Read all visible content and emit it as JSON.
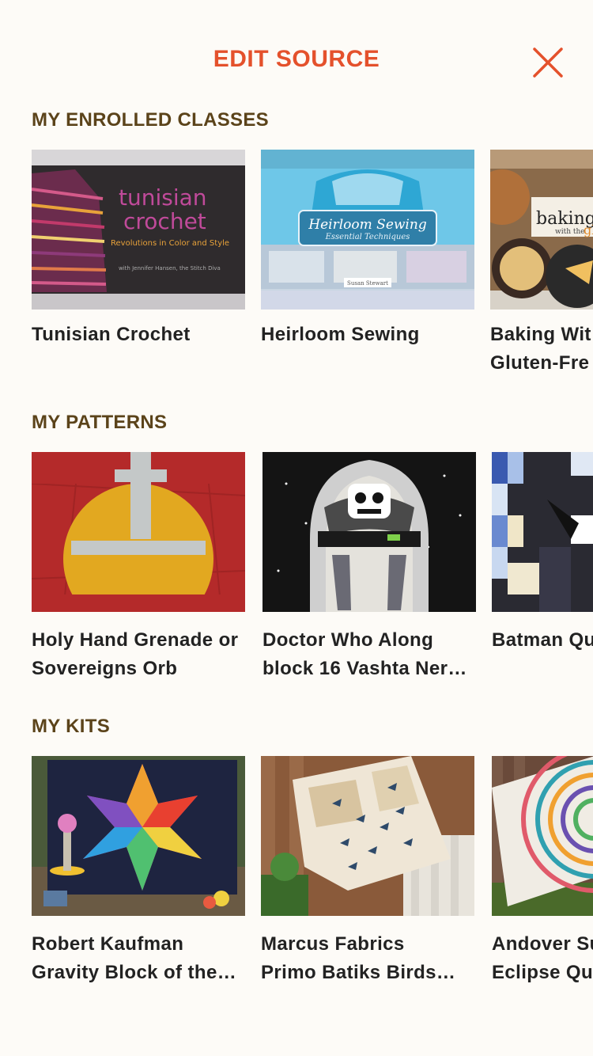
{
  "header": {
    "title": "EDIT SOURCE",
    "close_icon": "close-x-icon",
    "accent": "#e4512c"
  },
  "sections": {
    "classes": {
      "title": "MY ENROLLED CLASSES",
      "items": [
        {
          "line1": "Tunisian Crochet",
          "line2": "",
          "thumb_title": "tunisian crochet",
          "thumb_sub": "Revolutions in Color and Style",
          "thumb_credit": "with Jennifer Hansen, the Stitch Diva"
        },
        {
          "line1": "Heirloom Sewing",
          "line2": "",
          "thumb_title": "Heirloom Sewing",
          "thumb_sub": "Essential Techniques",
          "thumb_credit": "Susan Stewart"
        },
        {
          "line1": "Baking Wit",
          "line2": "Gluten-Fre",
          "thumb_title": "baking",
          "thumb_sub": "with the",
          "thumb_sub2": "gluten"
        }
      ]
    },
    "patterns": {
      "title": "MY PATTERNS",
      "items": [
        {
          "line1": "Holy Hand Grenade or",
          "line2": "Sovereigns Orb"
        },
        {
          "line1": "Doctor Who Along",
          "line2": "block 16 Vashta Ner…"
        },
        {
          "line1": "Batman Qu",
          "line2": ""
        }
      ]
    },
    "kits": {
      "title": "MY KITS",
      "items": [
        {
          "line1": "Robert Kaufman",
          "line2": "Gravity Block of the…"
        },
        {
          "line1": "Marcus Fabrics",
          "line2": "Primo Batiks Birds…"
        },
        {
          "line1": "Andover Su",
          "line2": "Eclipse Qu"
        }
      ]
    }
  }
}
